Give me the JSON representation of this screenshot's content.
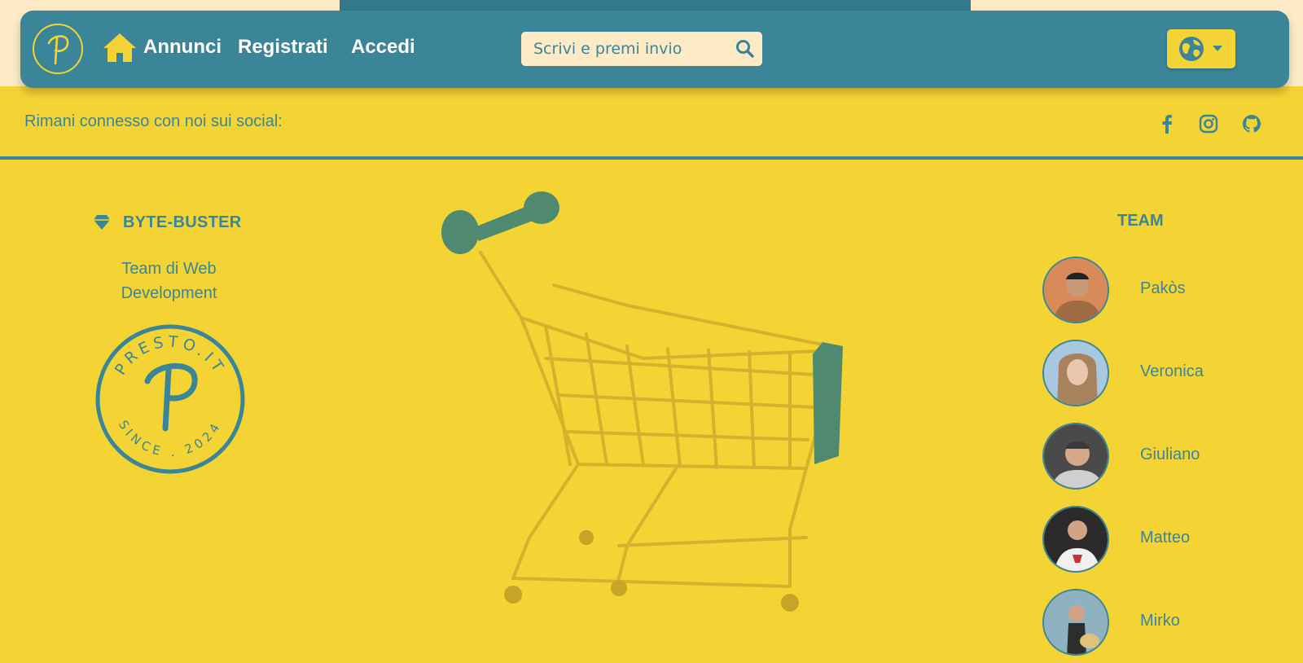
{
  "navbar": {
    "links": {
      "annunci": "Annunci",
      "registrati": "Registrati",
      "accedi": "Accedi"
    },
    "search": {
      "placeholder": "Scrivi e premi invio"
    },
    "icons": [
      "logo-p-icon",
      "home-icon",
      "search-icon",
      "globe-icon",
      "caret-down-icon"
    ]
  },
  "social": {
    "text": "Rimani connesso con noi sui social:",
    "icons": [
      "facebook-icon",
      "instagram-icon",
      "github-icon"
    ]
  },
  "footer": {
    "brand": {
      "title": "BYTE-BUSTER",
      "description": "Team di Web Development"
    },
    "seal": {
      "top_text": "PRESTO.IT",
      "bottom_text": "SINCE . 2024",
      "letter": "P"
    },
    "team": {
      "title": "TEAM",
      "members": [
        {
          "name": "Pakòs"
        },
        {
          "name": "Veronica"
        },
        {
          "name": "Giuliano"
        },
        {
          "name": "Matteo"
        },
        {
          "name": "Mirko"
        }
      ]
    }
  },
  "colors": {
    "primary": "#3a8597",
    "accent": "#f4d435",
    "cream": "#fcebc6",
    "white": "#ffffff"
  }
}
